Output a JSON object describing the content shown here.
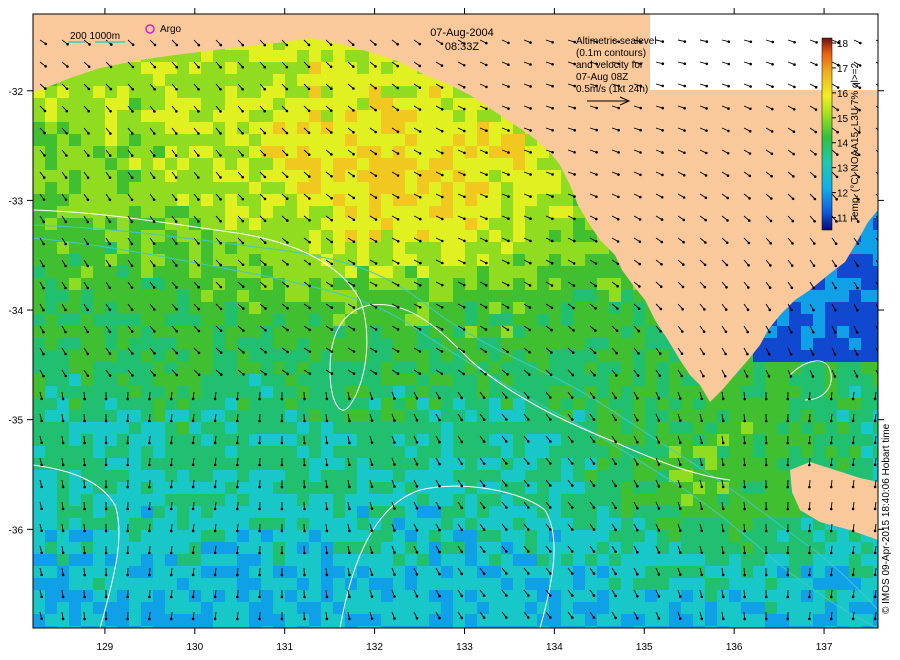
{
  "header": {
    "date": "07-Aug-2004",
    "time": "08:33Z"
  },
  "legend": {
    "bathy_label": "200  1000m",
    "argo_label": "Argo"
  },
  "annotation": {
    "lines": [
      "Altimetric sealevel",
      "(0.1m contours)",
      "and velocity for",
      "07-Aug 08Z",
      "0.5m/s (1kt 24h)"
    ]
  },
  "colorbar": {
    "title": "Temp. (°C) NOAA15_L3U 7% ql>=2",
    "ticks": [
      "11",
      "12",
      "13",
      "14",
      "15",
      "16",
      "17",
      "18"
    ],
    "min": 10.5,
    "max": 18.2
  },
  "axes": {
    "x_ticks": [
      "129",
      "130",
      "131",
      "132",
      "133",
      "134",
      "135",
      "136",
      "137"
    ],
    "y_ticks": [
      "-32",
      "-33",
      "-34",
      "-35",
      "-36"
    ],
    "lon_range": [
      128.2,
      137.6
    ],
    "lat_range": [
      -36.9,
      -31.3
    ]
  },
  "credit": "© IMOS 09-Apr-2015 18:40:06 Hobart time",
  "colors": {
    "land": "#f9c99b",
    "contour": "#ffffff",
    "bathy": "#40c8c8",
    "argo": "#d020d0",
    "arrow": "#000000"
  }
}
